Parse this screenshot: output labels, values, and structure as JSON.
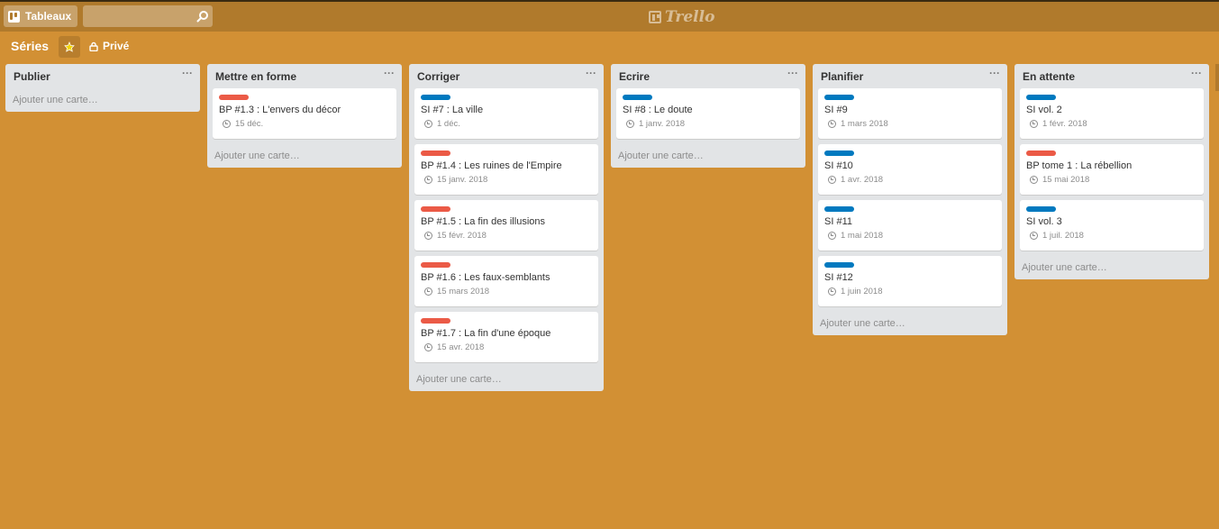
{
  "topbar": {
    "boards_label": "Tableaux",
    "search_value": "",
    "logo_text": "Trello"
  },
  "board": {
    "title": "Séries",
    "privacy": "Privé"
  },
  "colors": {
    "background": "#D29034",
    "topbar": "#B07A2C",
    "label_red": "#EB5A46",
    "label_blue": "#0079BF"
  },
  "lists": [
    {
      "title": "Publier",
      "menu": "···",
      "add_card": "Ajouter une carte…",
      "cards": []
    },
    {
      "title": "Mettre en forme",
      "menu": "···",
      "add_card": "Ajouter une carte…",
      "cards": [
        {
          "label": "red",
          "title": "BP #1.3 : L'envers du décor",
          "date": "15 déc."
        }
      ]
    },
    {
      "title": "Corriger",
      "menu": "···",
      "add_card": "Ajouter une carte…",
      "cards": [
        {
          "label": "blue",
          "title": "SI #7 : La ville",
          "date": "1 déc."
        },
        {
          "label": "red",
          "title": "BP #1.4 : Les ruines de l'Empire",
          "date": "15 janv. 2018"
        },
        {
          "label": "red",
          "title": "BP #1.5 : La fin des illusions",
          "date": "15 févr. 2018"
        },
        {
          "label": "red",
          "title": "BP #1.6 : Les faux-semblants",
          "date": "15 mars 2018"
        },
        {
          "label": "red",
          "title": "BP #1.7 : La fin d'une époque",
          "date": "15 avr. 2018"
        }
      ]
    },
    {
      "title": "Ecrire",
      "menu": "···",
      "add_card": "Ajouter une carte…",
      "cards": [
        {
          "label": "blue",
          "title": "SI #8 : Le doute",
          "date": "1 janv. 2018"
        }
      ]
    },
    {
      "title": "Planifier",
      "menu": "···",
      "add_card": "Ajouter une carte…",
      "cards": [
        {
          "label": "blue",
          "title": "SI #9",
          "date": "1 mars 2018"
        },
        {
          "label": "blue",
          "title": "SI #10",
          "date": "1 avr. 2018"
        },
        {
          "label": "blue",
          "title": "SI #11",
          "date": "1 mai 2018"
        },
        {
          "label": "blue",
          "title": "SI #12",
          "date": "1 juin 2018"
        }
      ]
    },
    {
      "title": "En attente",
      "menu": "···",
      "add_card": "Ajouter une carte…",
      "cards": [
        {
          "label": "blue",
          "title": "SI vol. 2",
          "date": "1 févr. 2018"
        },
        {
          "label": "red",
          "title": "BP tome 1 : La rébellion",
          "date": "15 mai 2018"
        },
        {
          "label": "blue",
          "title": "SI vol. 3",
          "date": "1 juil. 2018"
        }
      ]
    }
  ]
}
